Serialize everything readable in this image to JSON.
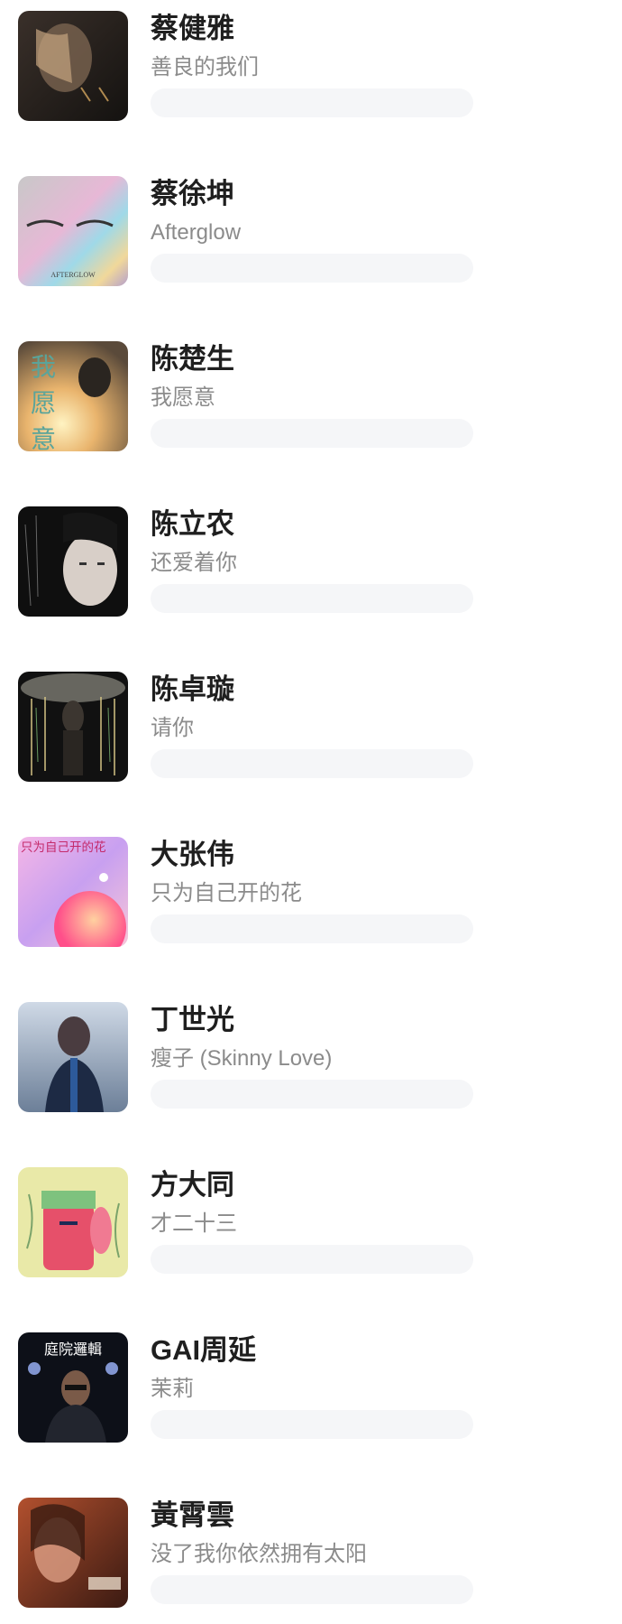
{
  "songs": [
    {
      "artist": "蔡健雅",
      "song": "善良的我们",
      "cover": "album-cover-1"
    },
    {
      "artist": "蔡徐坤",
      "song": "Afterglow",
      "cover": "album-cover-2",
      "cover_text": "AFTERGLOW"
    },
    {
      "artist": "陈楚生",
      "song": "我愿意",
      "cover": "album-cover-3",
      "cover_text": "我愿意"
    },
    {
      "artist": "陈立农",
      "song": "还爱着你",
      "cover": "album-cover-4"
    },
    {
      "artist": "陈卓璇",
      "song": "请你",
      "cover": "album-cover-5"
    },
    {
      "artist": "大张伟",
      "song": "只为自己开的花",
      "cover": "album-cover-6",
      "cover_text": "只为自己开的花"
    },
    {
      "artist": "丁世光",
      "song": "瘦子 (Skinny Love)",
      "cover": "album-cover-7"
    },
    {
      "artist": "方大同",
      "song": "才二十三",
      "cover": "album-cover-8"
    },
    {
      "artist": "GAI周延",
      "song": "茉莉",
      "cover": "album-cover-9",
      "cover_text": "庭院邏輯"
    },
    {
      "artist": "黃霄雲",
      "song": "没了我你依然拥有太阳",
      "cover": "album-cover-10"
    }
  ]
}
